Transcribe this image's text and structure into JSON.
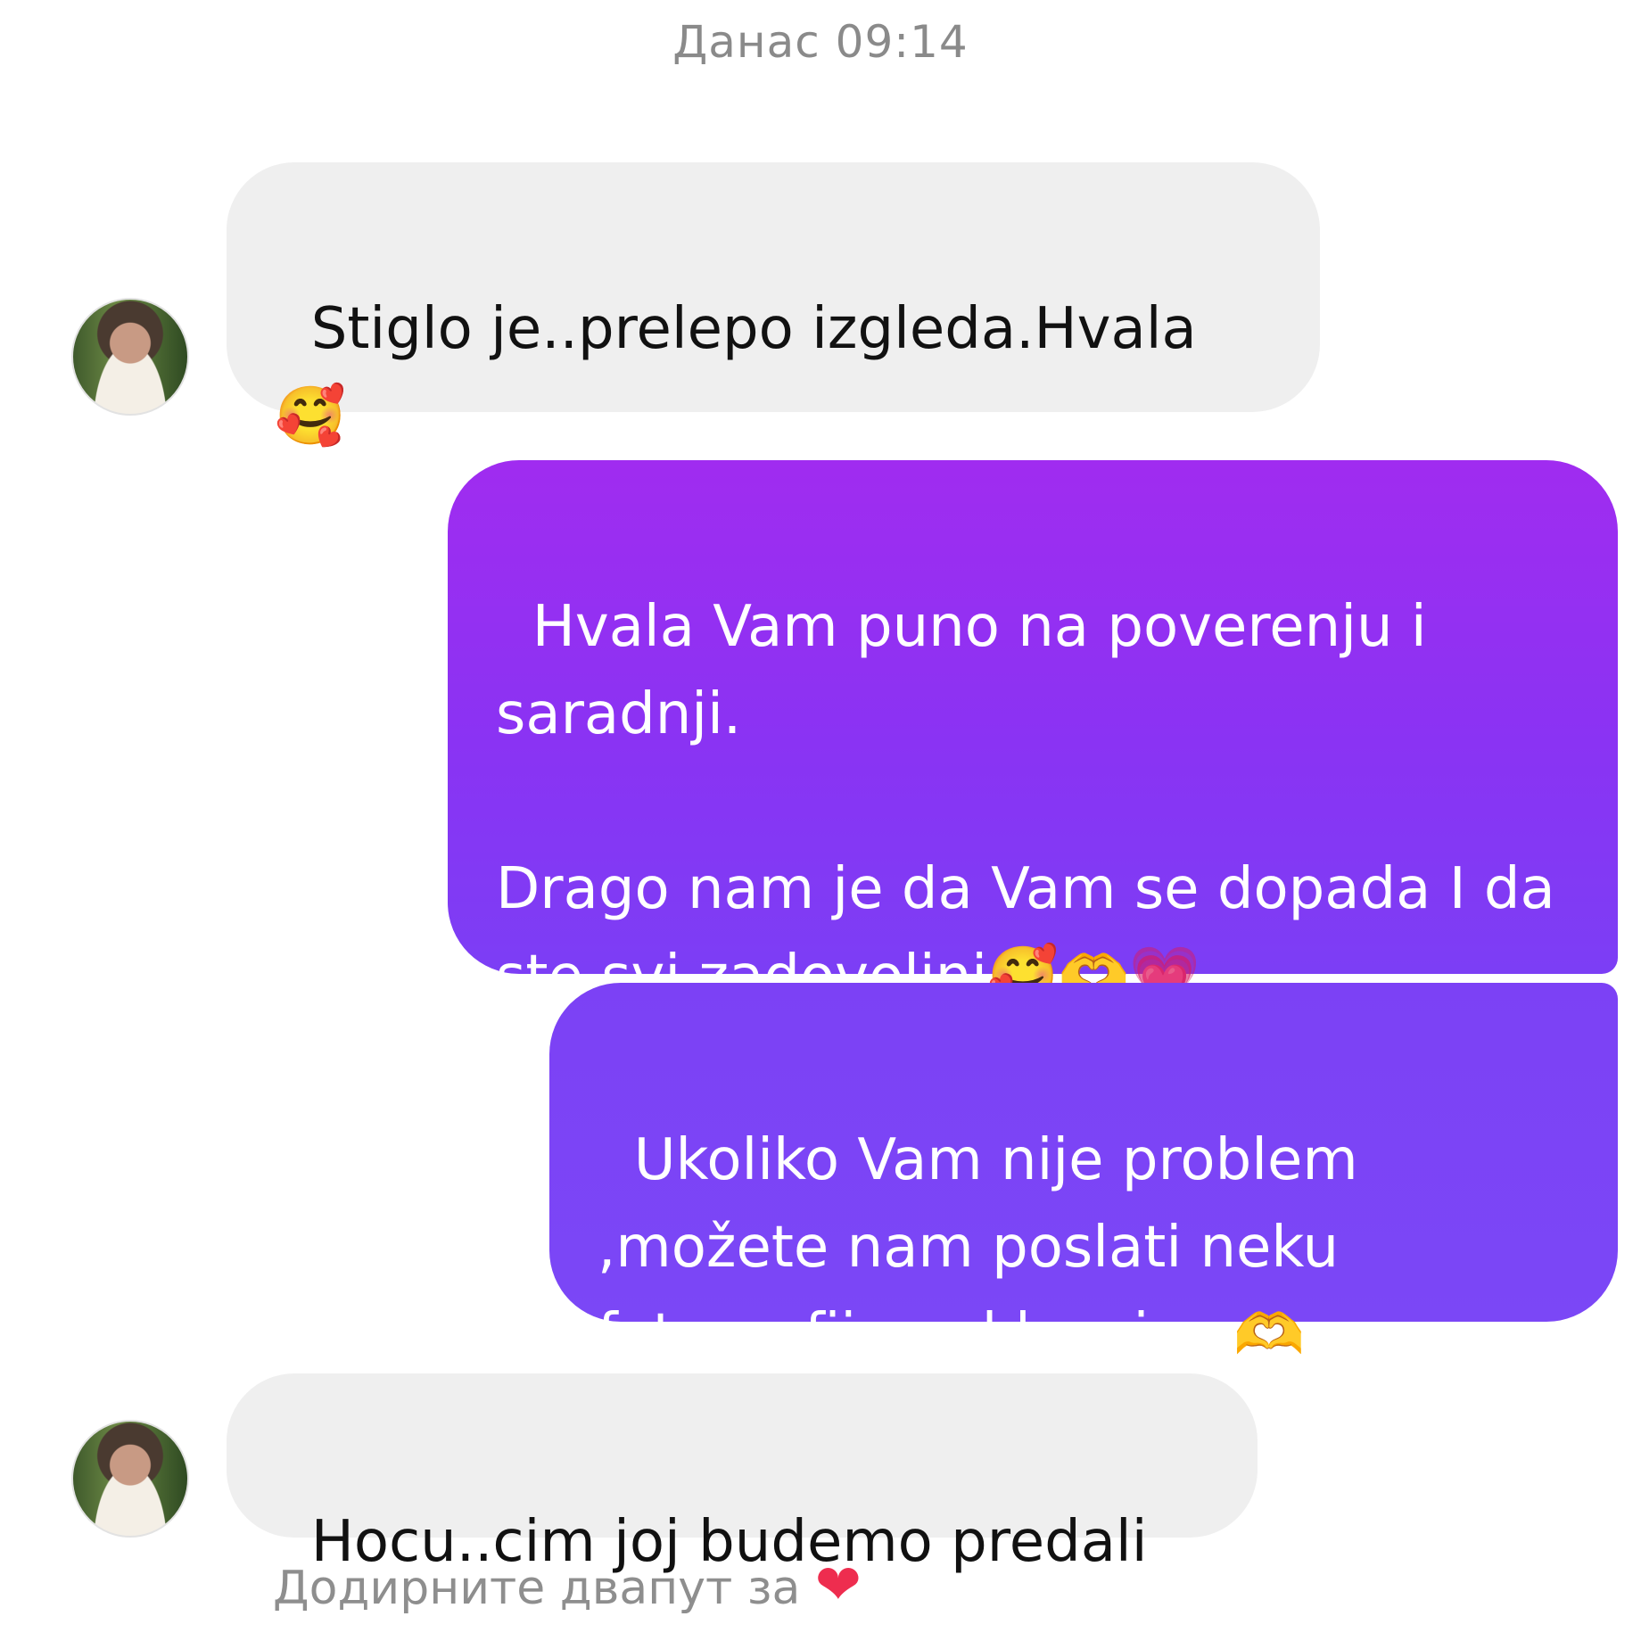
{
  "header": {
    "timestamp": "Данас 09:14"
  },
  "messages": [
    {
      "direction": "incoming",
      "text": "Stiglo je..prelepo izgleda.Hvala\n🥰"
    },
    {
      "direction": "outgoing",
      "text": "Hvala Vam puno na poverenju i saradnji.\n\nDrago nam je da Vam se dopada I da ste svi zadovoljni🥰🫶💗"
    },
    {
      "direction": "outgoing",
      "text": "Ukoliko Vam nije problem ,možete nam poslati neku fotografiju poklоncica 🫶"
    },
    {
      "direction": "incoming",
      "text": "Hocu..cim joj budemo predali"
    }
  ],
  "footer": {
    "double_tap_hint": "Додирните двапут за",
    "heart_glyph": "❤"
  },
  "colors": {
    "incoming_bubble": "#efefef",
    "outgoing_top": "#9b2cf0",
    "outgoing_bottom": "#7b3ff5",
    "timestamp_text": "#8a8a8a"
  }
}
